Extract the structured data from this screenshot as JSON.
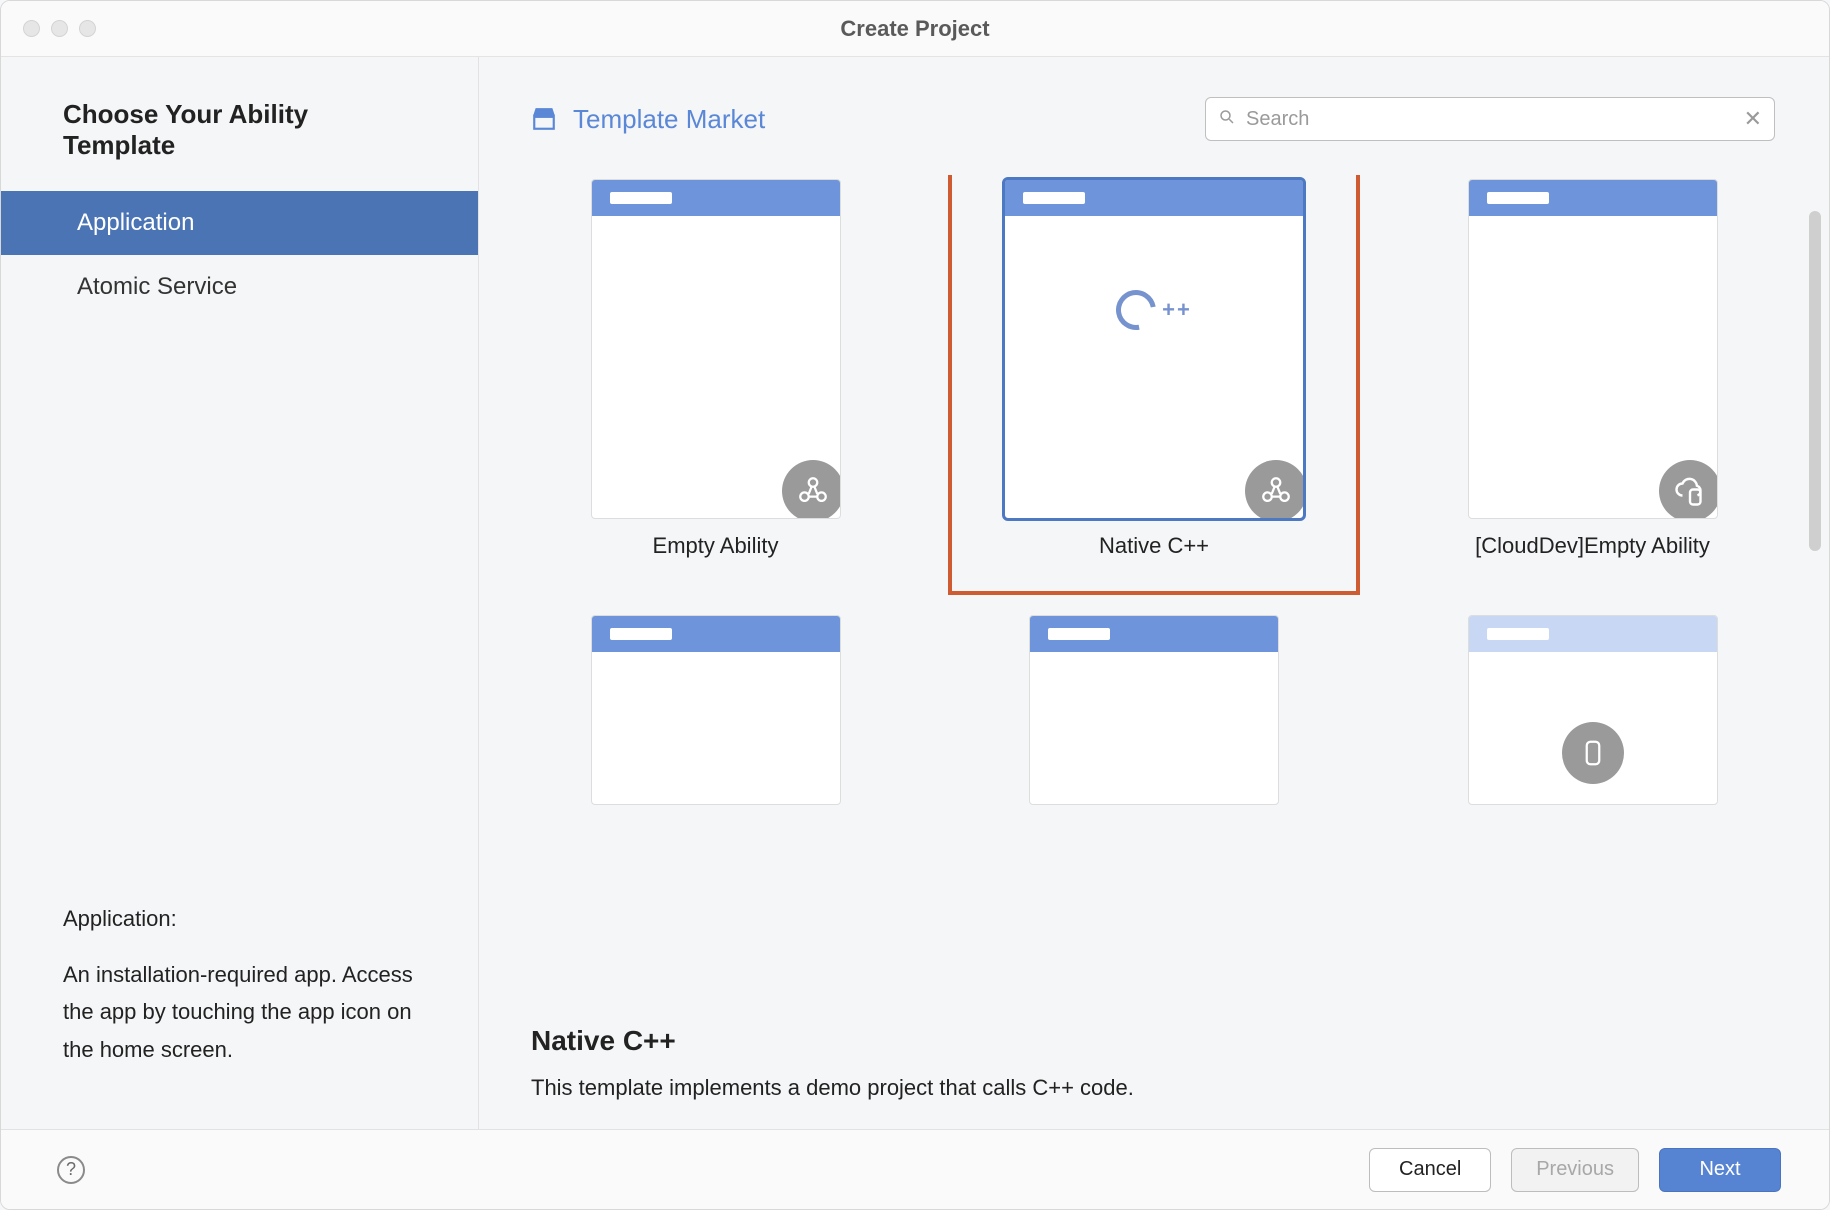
{
  "window": {
    "title": "Create Project"
  },
  "sidebar": {
    "heading": "Choose Your Ability Template",
    "items": [
      {
        "label": "Application",
        "active": true
      },
      {
        "label": "Atomic Service",
        "active": false
      }
    ],
    "desc_title": "Application:",
    "desc_body": "An installation-required app. Access the app by touching the app icon on the home screen."
  },
  "main": {
    "market_link": "Template Market",
    "search_placeholder": "Search",
    "templates": [
      {
        "label": "Empty Ability",
        "badge": "share",
        "selected": false,
        "highlighted": false,
        "faded": false
      },
      {
        "label": "Native C++",
        "badge": "share",
        "selected": true,
        "highlighted": true,
        "faded": false,
        "cpp": true
      },
      {
        "label": "[CloudDev]Empty Ability",
        "badge": "cloud",
        "selected": false,
        "highlighted": false,
        "faded": false
      },
      {
        "label": "",
        "badge": "",
        "selected": false,
        "highlighted": false,
        "faded": false,
        "row2": true
      },
      {
        "label": "",
        "badge": "",
        "selected": false,
        "highlighted": false,
        "faded": false,
        "row2": true
      },
      {
        "label": "",
        "badge": "phone",
        "selected": false,
        "highlighted": false,
        "faded": true,
        "row2": true
      }
    ],
    "detail_title": "Native C++",
    "detail_body": "This template implements a demo project that calls C++ code."
  },
  "footer": {
    "cancel": "Cancel",
    "previous": "Previous",
    "next": "Next"
  }
}
